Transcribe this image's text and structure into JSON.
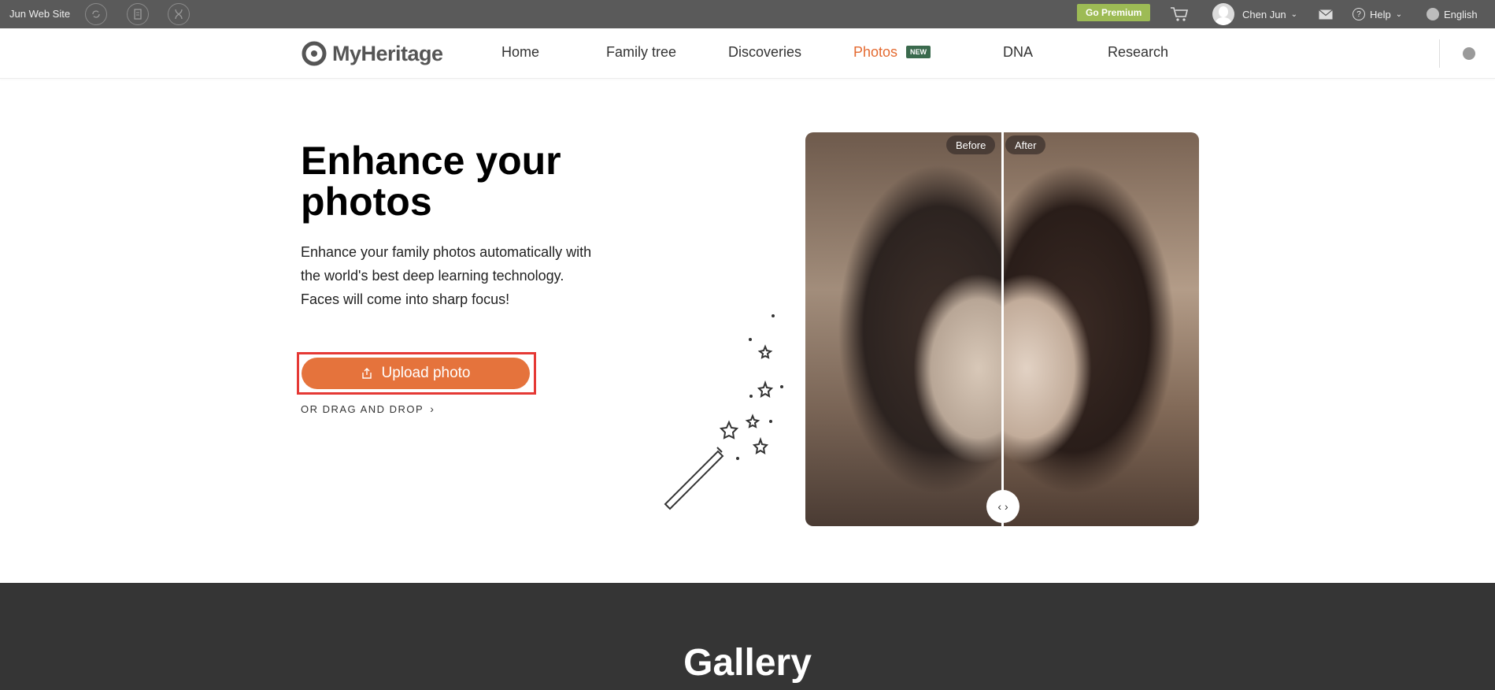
{
  "topbar": {
    "site_name": "Jun Web Site",
    "premium_label": "Go Premium",
    "user_name": "Chen Jun",
    "help_label": "Help",
    "language": "English"
  },
  "nav": {
    "brand": "MyHeritage",
    "items": [
      {
        "label": "Home"
      },
      {
        "label": "Family tree"
      },
      {
        "label": "Discoveries"
      },
      {
        "label": "Photos",
        "badge": "NEW"
      },
      {
        "label": "DNA"
      },
      {
        "label": "Research"
      }
    ],
    "active": "Photos"
  },
  "hero": {
    "title": "Enhance your photos",
    "desc_line1": "Enhance your family photos automatically with the world's best deep learning technology.",
    "desc_line2": "Faces will come into sharp focus!",
    "upload_label": "Upload photo",
    "drag_label": "OR DRAG AND DROP"
  },
  "compare": {
    "before_label": "Before",
    "after_label": "After"
  },
  "gallery": {
    "title": "Gallery"
  },
  "colors": {
    "accent": "#e5733c",
    "premium": "#9dbb55",
    "new_badge": "#3a6a4d",
    "highlight_frame": "#e53935"
  }
}
